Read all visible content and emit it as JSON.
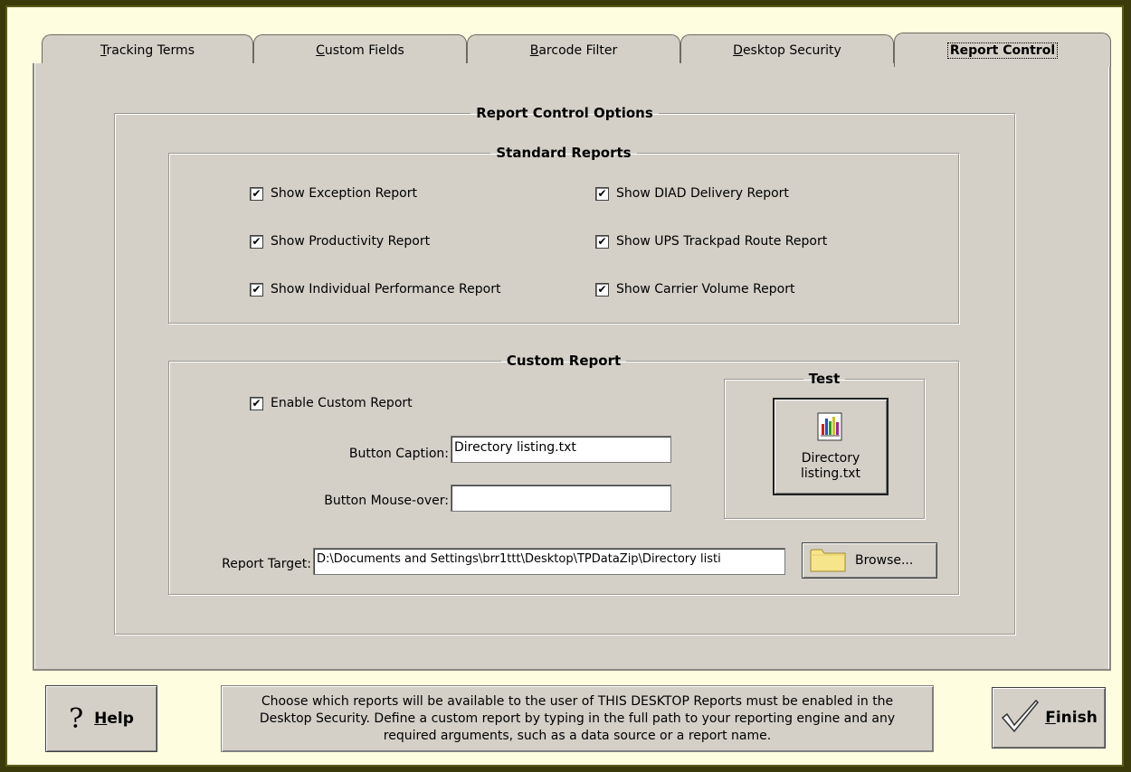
{
  "tabs": [
    {
      "label": "Tracking Terms",
      "mnemonic": "T",
      "rest": "racking Terms",
      "active": false
    },
    {
      "label": "Custom Fields",
      "mnemonic": "C",
      "rest": "ustom Fields",
      "active": false
    },
    {
      "label": "Barcode Filter",
      "mnemonic": "B",
      "rest": "arcode Filter",
      "active": false
    },
    {
      "label": "Desktop Security",
      "mnemonic": "D",
      "rest": "esktop Security",
      "active": false
    },
    {
      "label": "Report Control",
      "mnemonic": "",
      "rest": "Report Control",
      "active": true
    }
  ],
  "options_group": {
    "title": "Report Control Options"
  },
  "standard": {
    "title": "Standard Reports",
    "items": [
      {
        "label": "Show Exception Report",
        "checked": true
      },
      {
        "label": "Show Productivity Report",
        "checked": true
      },
      {
        "label": "Show Individual Performance Report",
        "checked": true
      },
      {
        "label": "Show DIAD Delivery Report",
        "checked": true
      },
      {
        "label": "Show UPS Trackpad Route Report",
        "checked": true
      },
      {
        "label": "Show Carrier Volume Report",
        "checked": true
      }
    ]
  },
  "custom": {
    "title": "Custom Report",
    "enable_label": "Enable Custom Report",
    "enable_checked": true,
    "caption_label": "Button Caption:",
    "caption_value": "Directory listing.txt",
    "mouseover_label": "Button Mouse-over:",
    "mouseover_value": "",
    "target_label": "Report Target:",
    "target_value": "D:\\Documents and Settings\\brr1ttt\\Desktop\\TPDataZip\\Directory listi",
    "browse_label": "Browse...",
    "test": {
      "title": "Test",
      "button_line1": "Directory",
      "button_line2": "listing.txt"
    }
  },
  "footer": {
    "help_mnemonic": "H",
    "help_rest": "elp",
    "finish_mnemonic": "F",
    "finish_rest": "inish",
    "message": "Choose which reports will be available to the user of THIS DESKTOP Reports must be enabled in the Desktop Security.  Define a custom report by typing in the full path to your reporting engine and any required arguments, such as a data source or a report name."
  },
  "check_glyph": "✔",
  "icons": [
    "chart-icon",
    "folder-icon",
    "question-icon",
    "checkmark-icon"
  ]
}
